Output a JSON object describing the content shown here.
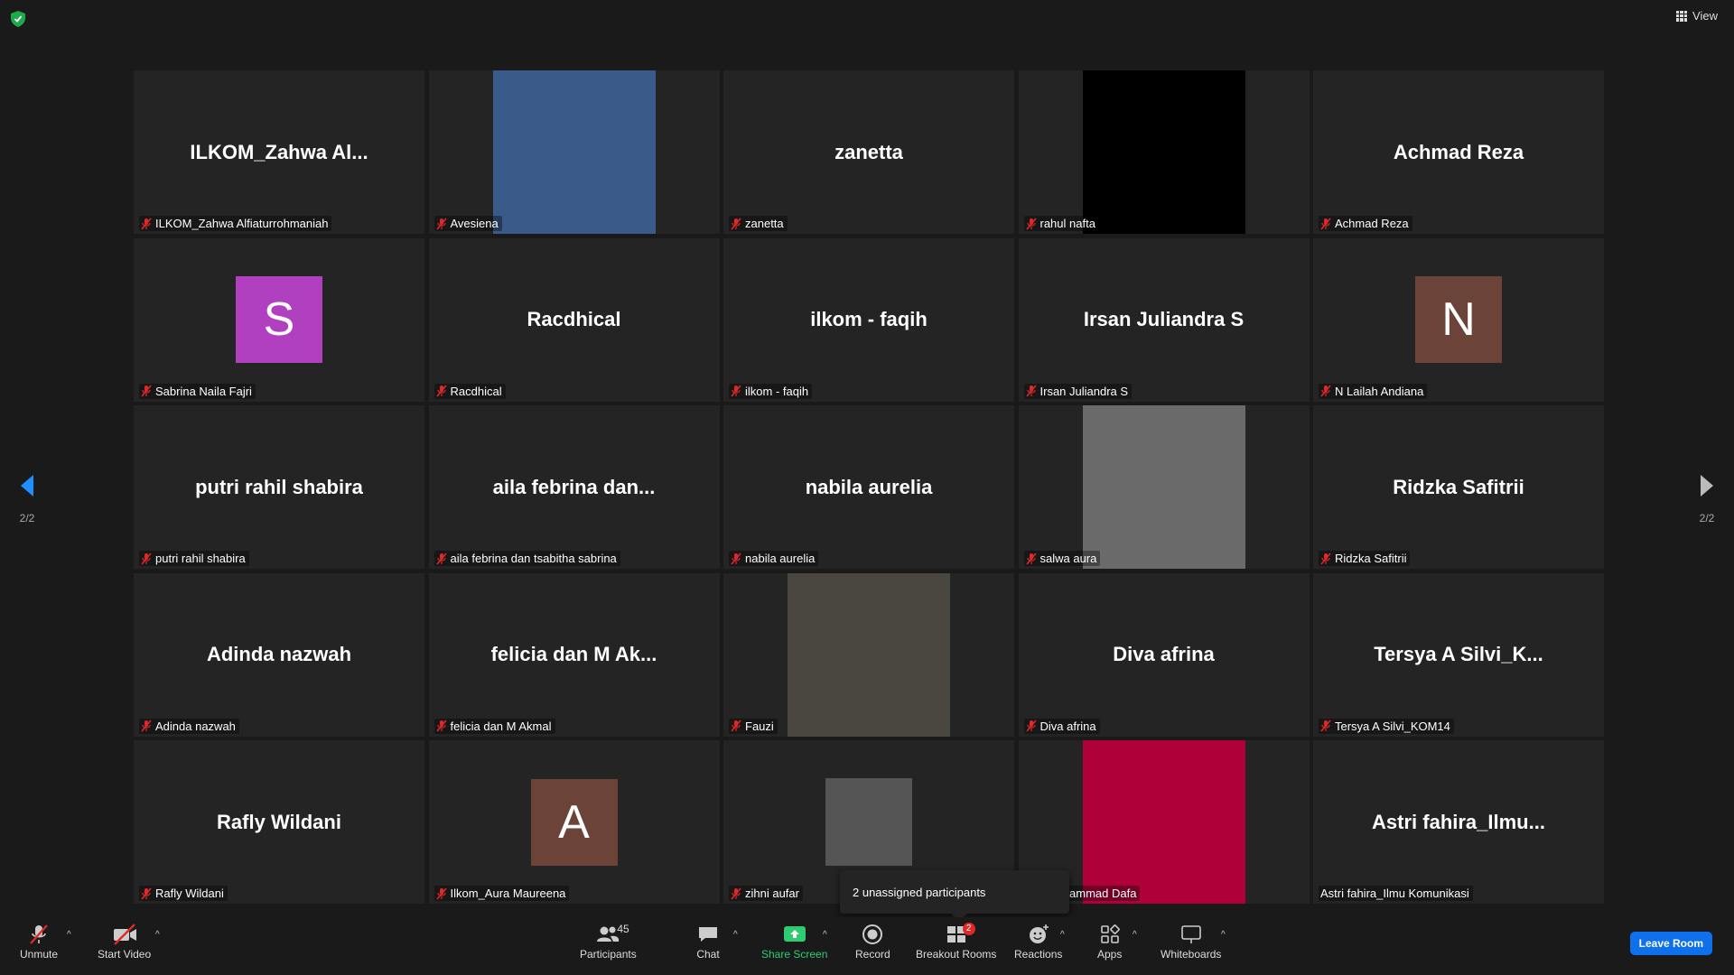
{
  "top": {
    "view_label": "View"
  },
  "tiles": [
    {
      "display": "ILKOM_Zahwa  Al...",
      "label": "ILKOM_Zahwa Alfiaturrohmaniah",
      "type": "name"
    },
    {
      "display": "",
      "label": "Avesiena",
      "type": "video",
      "color": "#3a5a8a"
    },
    {
      "display": "zanetta",
      "label": "zanetta",
      "type": "name"
    },
    {
      "display": "",
      "label": "rahul nafta",
      "type": "video",
      "color": "#000000"
    },
    {
      "display": "Achmad Reza",
      "label": "Achmad Reza",
      "type": "name"
    },
    {
      "display": "S",
      "label": "Sabrina Naila Fajri",
      "type": "avatar",
      "color": "#b040c0"
    },
    {
      "display": "Racdhical",
      "label": "Racdhical",
      "type": "name"
    },
    {
      "display": "ilkom - faqih",
      "label": "ilkom - faqih",
      "type": "name"
    },
    {
      "display": "Irsan Juliandra S",
      "label": "Irsan Juliandra S",
      "type": "name"
    },
    {
      "display": "N",
      "label": "N Lailah Andiana",
      "type": "avatar",
      "color": "#6b4338"
    },
    {
      "display": "putri rahil shabira",
      "label": "putri rahil shabira",
      "type": "name"
    },
    {
      "display": "aila febrina dan...",
      "label": "aila febrina dan tsabitha sabrina",
      "type": "name"
    },
    {
      "display": "nabila aurelia",
      "label": "nabila aurelia",
      "type": "name"
    },
    {
      "display": "",
      "label": "salwa aura",
      "type": "video",
      "color": "#6a6a6a"
    },
    {
      "display": "Ridzka Safitrii",
      "label": "Ridzka Safitrii",
      "type": "name"
    },
    {
      "display": "Adinda nazwah",
      "label": "Adinda nazwah",
      "type": "name"
    },
    {
      "display": "felicia dan M Ak...",
      "label": "felicia dan M Akmal",
      "type": "name"
    },
    {
      "display": "",
      "label": "Fauzi",
      "type": "video",
      "color": "#4a4740"
    },
    {
      "display": "Diva afrina",
      "label": "Diva afrina",
      "type": "name"
    },
    {
      "display": "Tersya A Silvi_K...",
      "label": "Tersya A Silvi_KOM14",
      "type": "name"
    },
    {
      "display": "Rafly Wildani",
      "label": "Rafly Wildani",
      "type": "name"
    },
    {
      "display": "A",
      "label": "Ilkom_Aura Maureena",
      "type": "avatar",
      "color": "#6b4338"
    },
    {
      "display": "",
      "label": "zihni aufar",
      "type": "smallvideo",
      "color": "#555555"
    },
    {
      "display": "",
      "label": "_Muhammad Dafa",
      "type": "video",
      "color": "#b0003a"
    },
    {
      "display": "Astri  fahira_Ilmu...",
      "label": "Astri fahira_Ilmu Komunikasi",
      "type": "name",
      "nomic": true
    }
  ],
  "paging": {
    "left": "2/2",
    "right": "2/2"
  },
  "popup": {
    "text": "2 unassigned participants"
  },
  "toolbar": {
    "unmute": "Unmute",
    "start_video": "Start Video",
    "participants": "Participants",
    "participants_count": "45",
    "chat": "Chat",
    "share_screen": "Share Screen",
    "record": "Record",
    "breakout_rooms": "Breakout Rooms",
    "breakout_badge": "2",
    "reactions": "Reactions",
    "apps": "Apps",
    "whiteboards": "Whiteboards",
    "leave_room": "Leave Room"
  },
  "colors": {
    "accent": "#0e71eb",
    "share": "#2ecc71",
    "muted": "#e02828"
  }
}
